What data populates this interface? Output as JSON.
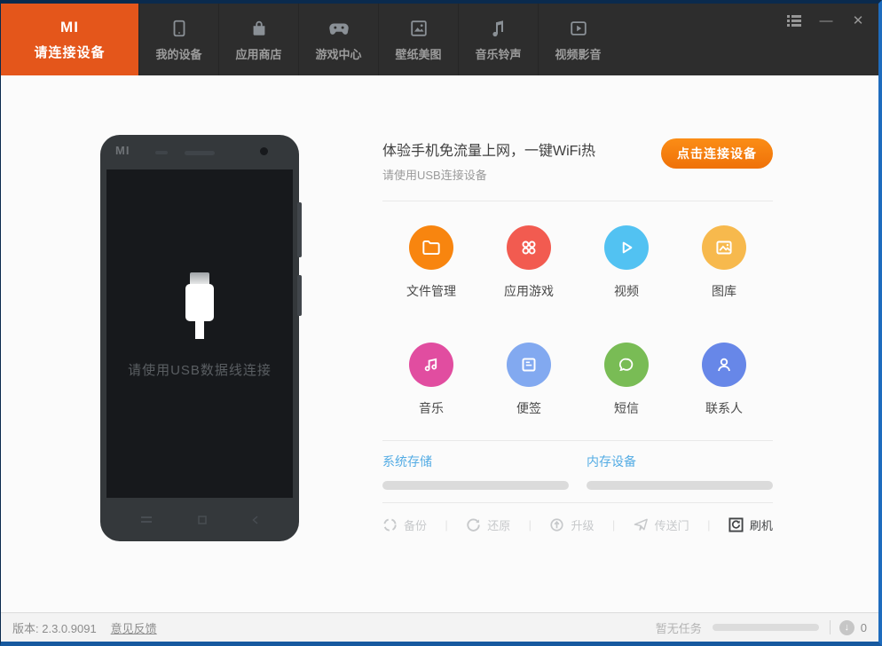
{
  "navbar": {
    "active_tab": {
      "logo": "MI",
      "label": "请连接设备"
    },
    "tabs": [
      {
        "label": "我的设备"
      },
      {
        "label": "应用商店"
      },
      {
        "label": "游戏中心"
      },
      {
        "label": "壁纸美图"
      },
      {
        "label": "音乐铃声"
      },
      {
        "label": "视频影音"
      }
    ],
    "controls": {
      "minimize": "—",
      "close": "✕"
    }
  },
  "phone": {
    "logo": "MI",
    "screen_text": "请使用USB数据线连接"
  },
  "panel": {
    "title": "体验手机免流量上网，一键WiFi热",
    "subtitle": "请使用USB连接设备",
    "connect_button": "点击连接设备",
    "apps": [
      {
        "label": "文件管理",
        "color": "#f8850f"
      },
      {
        "label": "应用游戏",
        "color": "#f25b50"
      },
      {
        "label": "视频",
        "color": "#52c2f2"
      },
      {
        "label": "图库",
        "color": "#f7b94d"
      },
      {
        "label": "音乐",
        "color": "#e14da0"
      },
      {
        "label": "便签",
        "color": "#82a9f0"
      },
      {
        "label": "短信",
        "color": "#79bc55"
      },
      {
        "label": "联系人",
        "color": "#6787e8"
      }
    ],
    "storage": [
      {
        "label": "系统存储",
        "percent": 0
      },
      {
        "label": "内存设备",
        "percent": 0
      }
    ],
    "tools": [
      {
        "label": "备份",
        "enabled": false
      },
      {
        "label": "还原",
        "enabled": false
      },
      {
        "label": "升级",
        "enabled": false
      },
      {
        "label": "传送门",
        "enabled": false
      },
      {
        "label": "刷机",
        "enabled": true
      }
    ]
  },
  "footer": {
    "version": "版本: 2.3.0.9091",
    "feedback": "意见反馈",
    "task_status": "暂无任务",
    "download_count": "0"
  }
}
